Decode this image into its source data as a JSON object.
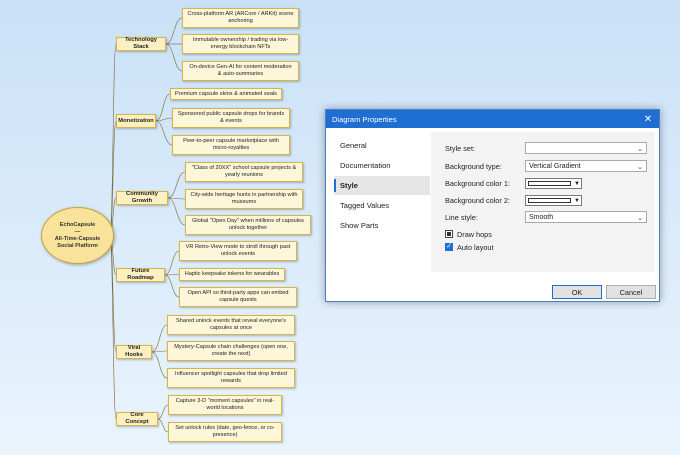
{
  "mindmap": {
    "root": {
      "line1": "EchoCapsule",
      "line2": "—",
      "line3": "All-Time-Capsule",
      "line4": "Social Platform"
    },
    "categories": [
      {
        "label": "Technology Stack",
        "children": [
          "Cross-platform AR (ARCore / ARKit) scene anchoring",
          "Immutable ownership / trading via low-energy blockchain NFTs",
          "On-device Gen-AI for content moderation & auto-summaries"
        ]
      },
      {
        "label": "Monetization",
        "children": [
          "Premium capsule skins & animated seals",
          "Sponsored public capsule drops for brands & events",
          "Peer-to-peer capsule marketplace with micro-royalties"
        ]
      },
      {
        "label": "Community Growth",
        "children": [
          "\"Class of 20XX\" school capsule projects & yearly reunions",
          "City-wide heritage hunts in partnership with museums",
          "Global \"Open Day\" when millions of capsules unlock together"
        ]
      },
      {
        "label": "Future Roadmap",
        "children": [
          "VR Retro-View mode to stroll through past unlock events",
          "Haptic keepsake tokens for wearables",
          "Open API so third-party apps can embed capsule quests"
        ]
      },
      {
        "label": "Viral Hooks",
        "children": [
          "Shared unlock events that reveal everyone's capsules at once",
          "Mystery-Capsule chain challenges (open one, create the next)",
          "Influencer spotlight capsules that drop limited rewards"
        ]
      },
      {
        "label": "Core Concept",
        "children": [
          "Capture 3-D \"moment capsules\" in real-world locations",
          "Set unlock rules (date, geo-fence, or co-presence)"
        ]
      }
    ]
  },
  "dialog": {
    "title": "Diagram Properties",
    "close_glyph": "✕",
    "nav": [
      "General",
      "Documentation",
      "Style",
      "Tagged Values",
      "Show Parts"
    ],
    "style_set_label": "Style set:",
    "style_set_value": "",
    "background_type_label": "Background type:",
    "background_type_value": "Vertical Gradient",
    "bg_color1_label": "Background color 1:",
    "bg_color2_label": "Background color 2:",
    "line_style_label": "Line style:",
    "line_style_value": "Smooth",
    "draw_hops_label": "Draw hops",
    "auto_layout_label": "Auto layout",
    "ok_label": "OK",
    "cancel_label": "Cancel",
    "chevron_glyph": "⌄",
    "arrow_glyph": "▼",
    "tick_glyph": "✓"
  },
  "colors": {
    "accent": "#1f6fd2",
    "node_fill": "#fdf6d8",
    "node_border": "#d6b44a",
    "link": "#7a6a3a"
  }
}
